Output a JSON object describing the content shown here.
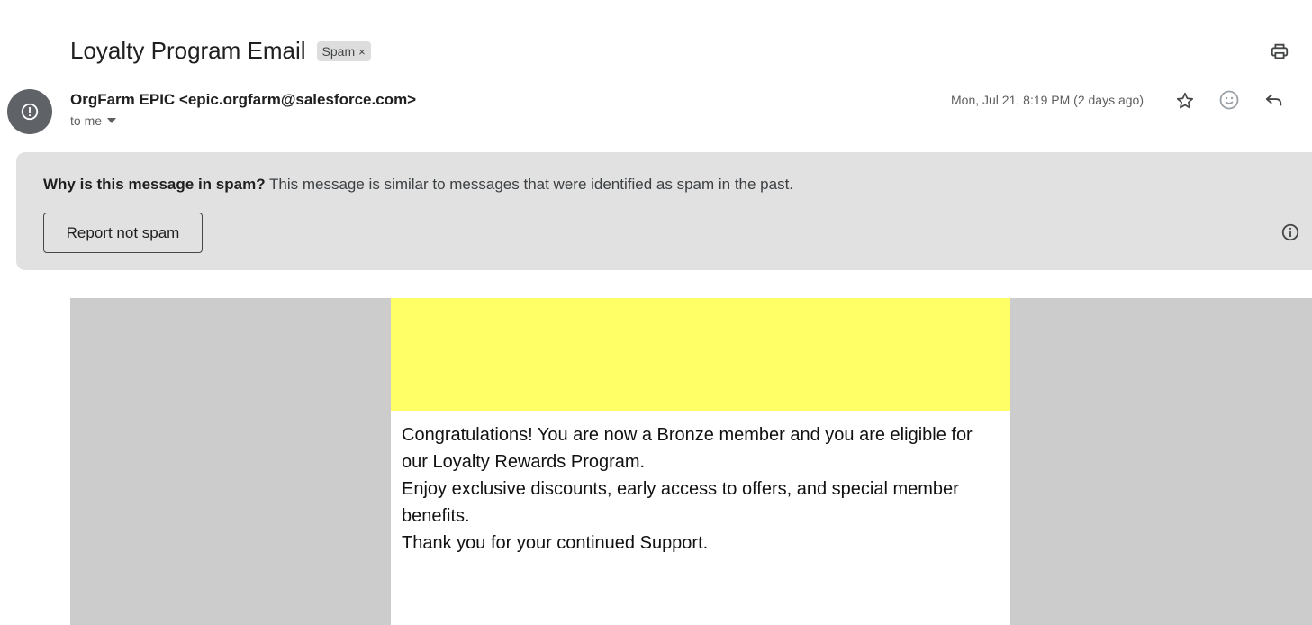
{
  "subject": {
    "title": "Loyalty Program Email",
    "label_chip": "Spam",
    "chip_remove": "×"
  },
  "sender": {
    "display": "OrgFarm EPIC <epic.orgfarm@salesforce.com>",
    "recipient": "to me",
    "timestamp": "Mon, Jul 21, 8:19 PM (2 days ago)"
  },
  "spam_notice": {
    "heading": "Why is this message in spam?",
    "reason": " This message is similar to messages that were identified as spam in the past.",
    "button_label": "Report not spam"
  },
  "email": {
    "lines": [
      "Congratulations! You are now a Bronze member and you are eligible for our Loyalty Rewards Program.",
      "Enjoy exclusive discounts, early access to offers, and special member benefits.",
      "Thank you for your continued Support."
    ],
    "header_color": "#ffff66",
    "frame_color": "#cccccc"
  },
  "icons": {
    "print": "print-icon",
    "avatar": "alert-icon",
    "star": "star-icon",
    "emoji": "emoji-icon",
    "reply": "reply-icon",
    "info": "info-icon",
    "recipient_caret": "caret-down-icon"
  }
}
